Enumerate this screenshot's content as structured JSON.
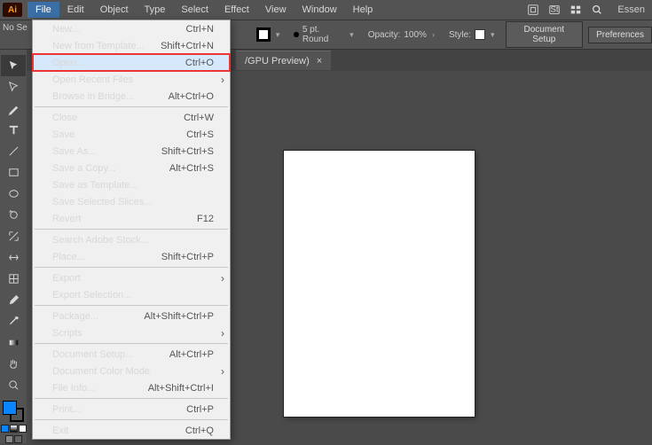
{
  "app_badge": "Ai",
  "menubar": [
    "File",
    "Edit",
    "Object",
    "Type",
    "Select",
    "Effect",
    "View",
    "Window",
    "Help"
  ],
  "controlbar": {
    "no_selection": "No Se",
    "stroke_label": "5 pt. Round",
    "opacity_label": "Opacity:",
    "opacity_value": "100%",
    "style_label": "Style:",
    "doc_setup": "Document Setup",
    "preferences": "Preferences"
  },
  "tab": {
    "label": "/GPU Preview)",
    "close": "×"
  },
  "essentials": "Essen",
  "dropdown": [
    {
      "label": "New...",
      "shortcut": "Ctrl+N"
    },
    {
      "label": "New from Template...",
      "shortcut": "Shift+Ctrl+N"
    },
    {
      "label": "Open...",
      "shortcut": "Ctrl+O",
      "highlight": true
    },
    {
      "label": "Open Recent Files",
      "sub": true
    },
    {
      "label": "Browse in Bridge...",
      "shortcut": "Alt+Ctrl+O"
    },
    {
      "sep": true
    },
    {
      "label": "Close",
      "shortcut": "Ctrl+W"
    },
    {
      "label": "Save",
      "shortcut": "Ctrl+S"
    },
    {
      "label": "Save As...",
      "shortcut": "Shift+Ctrl+S"
    },
    {
      "label": "Save a Copy...",
      "shortcut": "Alt+Ctrl+S"
    },
    {
      "label": "Save as Template..."
    },
    {
      "label": "Save Selected Slices..."
    },
    {
      "label": "Revert",
      "shortcut": "F12"
    },
    {
      "sep": true
    },
    {
      "label": "Search Adobe Stock..."
    },
    {
      "label": "Place...",
      "shortcut": "Shift+Ctrl+P"
    },
    {
      "sep": true
    },
    {
      "label": "Export",
      "sub": true
    },
    {
      "label": "Export Selection...",
      "disabled": true
    },
    {
      "sep": true
    },
    {
      "label": "Package...",
      "shortcut": "Alt+Shift+Ctrl+P"
    },
    {
      "label": "Scripts",
      "sub": true
    },
    {
      "sep": true
    },
    {
      "label": "Document Setup...",
      "shortcut": "Alt+Ctrl+P"
    },
    {
      "label": "Document Color Mode",
      "sub": true
    },
    {
      "label": "File Info...",
      "shortcut": "Alt+Shift+Ctrl+I"
    },
    {
      "sep": true
    },
    {
      "label": "Print...",
      "shortcut": "Ctrl+P"
    },
    {
      "sep": true
    },
    {
      "label": "Exit",
      "shortcut": "Ctrl+Q"
    }
  ],
  "tools": [
    "selection",
    "direct-selection",
    "pen",
    "type",
    "line",
    "rectangle",
    "ellipse",
    "rotate",
    "scale",
    "width",
    "mesh",
    "brush",
    "eyedropper",
    "gradient",
    "hand",
    "zoom"
  ]
}
